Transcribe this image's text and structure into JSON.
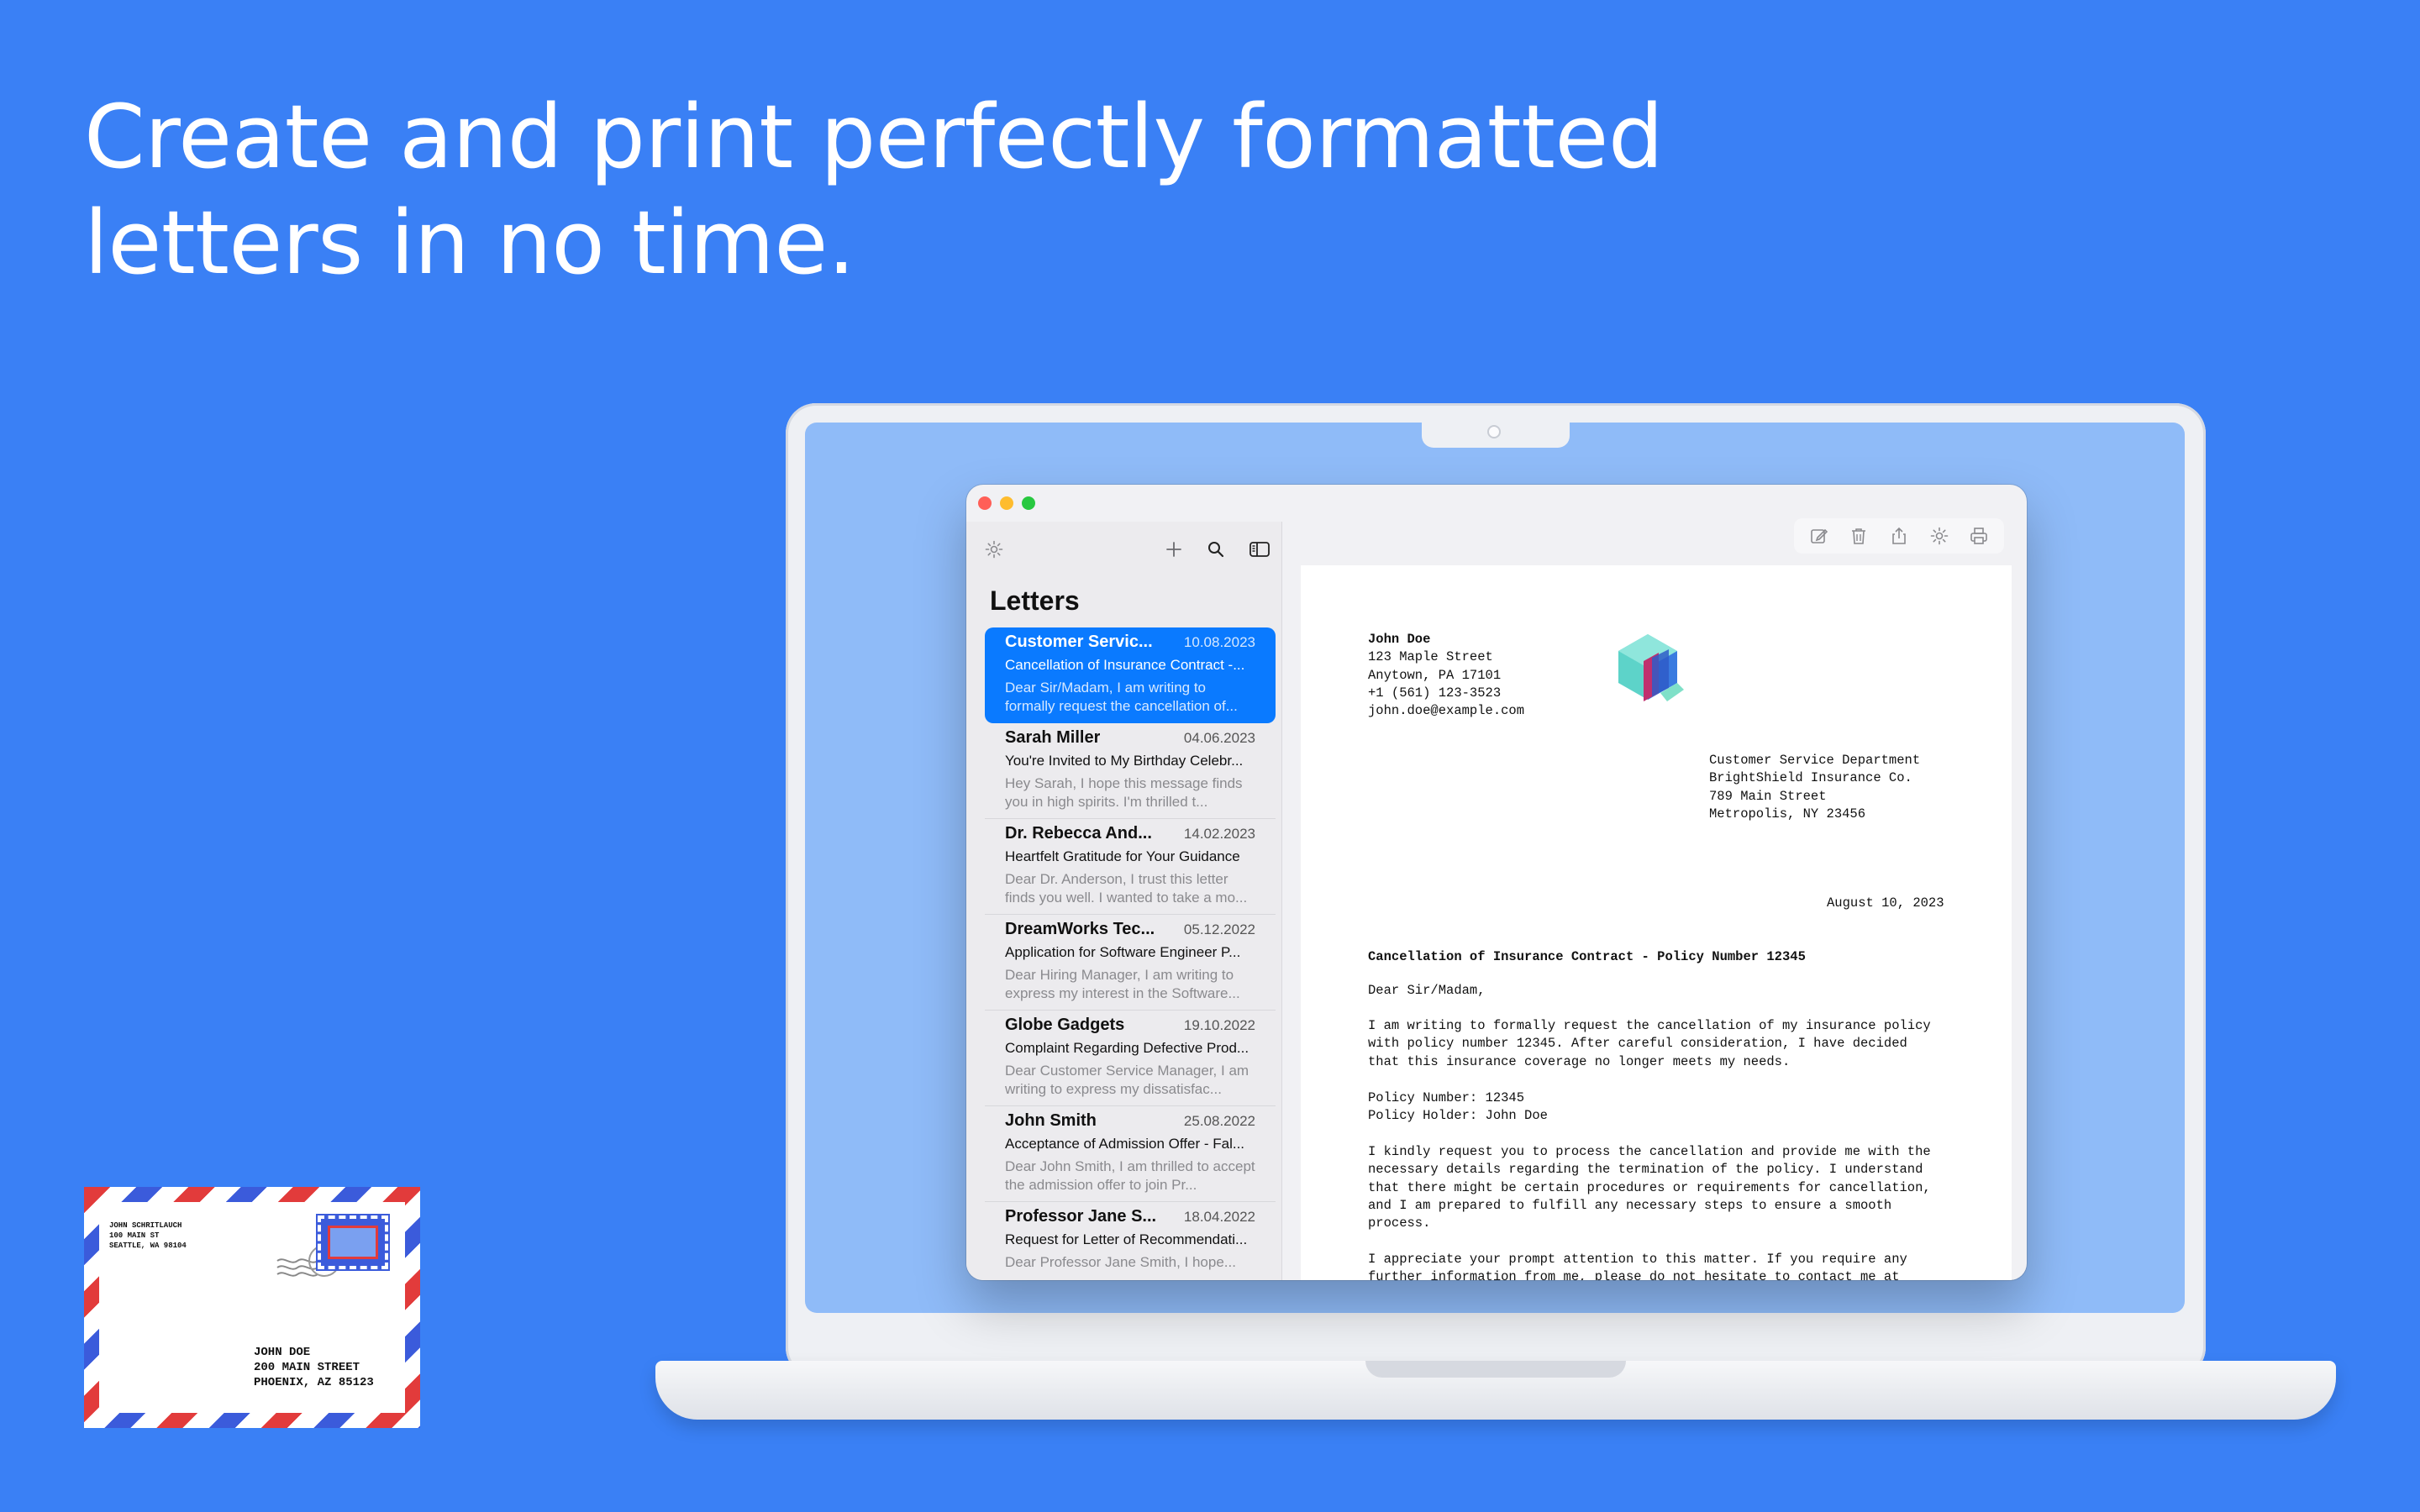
{
  "headline": {
    "line1": "Create and print perfectly formatted",
    "line2": "letters in no time."
  },
  "sidebar": {
    "title": "Letters",
    "icons": [
      "gear-icon",
      "plus-icon",
      "search-icon",
      "sidebar-toggle-icon"
    ],
    "items": [
      {
        "name": "Customer Servic...",
        "date": "10.08.2023",
        "subject": "Cancellation of Insurance Contract -...",
        "preview": "Dear Sir/Madam,  I am writing to formally request the cancellation of...",
        "selected": true
      },
      {
        "name": "Sarah Miller",
        "date": "04.06.2023",
        "subject": "You're Invited to My Birthday Celebr...",
        "preview": "Hey Sarah,  I hope this message finds you in high spirits. I'm thrilled t..."
      },
      {
        "name": "Dr. Rebecca And...",
        "date": "14.02.2023",
        "subject": "Heartfelt Gratitude for Your Guidance",
        "preview": "Dear Dr. Anderson,  I trust this letter finds you well. I wanted to take a mo..."
      },
      {
        "name": "DreamWorks Tec...",
        "date": "05.12.2022",
        "subject": "Application for Software Engineer P...",
        "preview": "Dear Hiring Manager,  I am writing to express my interest in the Software..."
      },
      {
        "name": "Globe Gadgets",
        "date": "19.10.2022",
        "subject": "Complaint Regarding Defective Prod...",
        "preview": "Dear Customer Service Manager,  I am writing to express my dissatisfac..."
      },
      {
        "name": "John Smith",
        "date": "25.08.2022",
        "subject": "Acceptance of Admission Offer - Fal...",
        "preview": "Dear John Smith,  I am thrilled to accept the admission offer to join Pr..."
      },
      {
        "name": "Professor Jane S...",
        "date": "18.04.2022",
        "subject": "Request for Letter of Recommendati...",
        "preview": "Dear Professor Jane Smith,  I hope..."
      }
    ]
  },
  "toolbar": {
    "icons": [
      "compose-icon",
      "trash-icon",
      "share-icon",
      "gear-icon",
      "print-icon"
    ]
  },
  "document": {
    "sender": {
      "name": "John Doe",
      "street": "123 Maple Street",
      "city": "Anytown, PA 17101",
      "phone": "+1 (561) 123-3523",
      "email": "john.doe@example.com"
    },
    "recipient": {
      "line1": "Customer Service Department",
      "line2": "BrightShield Insurance Co.",
      "line3": "789 Main Street",
      "line4": "Metropolis, NY 23456"
    },
    "date": "August 10, 2023",
    "subject": "Cancellation of Insurance Contract - Policy Number 12345",
    "salutation": "Dear Sir/Madam,",
    "para1": [
      "I am writing to formally request the cancellation of my insurance policy",
      "with policy number 12345. After careful consideration, I have decided",
      "that this insurance coverage no longer meets my needs."
    ],
    "policy": [
      "Policy Number: 12345",
      "Policy Holder: John Doe"
    ],
    "para2": [
      "I kindly request you to process the cancellation and provide me with the",
      "necessary details regarding the termination of the policy. I understand",
      "that there might be certain procedures or requirements for cancellation,",
      "and I am prepared to fulfill any necessary steps to ensure a smooth",
      "process."
    ],
    "para3": [
      "I appreciate your prompt attention to this matter. If you require any",
      "further information from me, please do not hesitate to contact me at"
    ]
  },
  "envelope": {
    "from": [
      "JOHN SCHRITLAUCH",
      "100 MAIN ST",
      "SEATTLE, WA 98104"
    ],
    "to": [
      "JOHN DOE",
      "200 MAIN STREET",
      "PHOENIX, AZ 85123"
    ]
  },
  "colors": {
    "background": "#3a80f5",
    "selection": "#0a7aff",
    "screen": "#8fbbf8"
  }
}
